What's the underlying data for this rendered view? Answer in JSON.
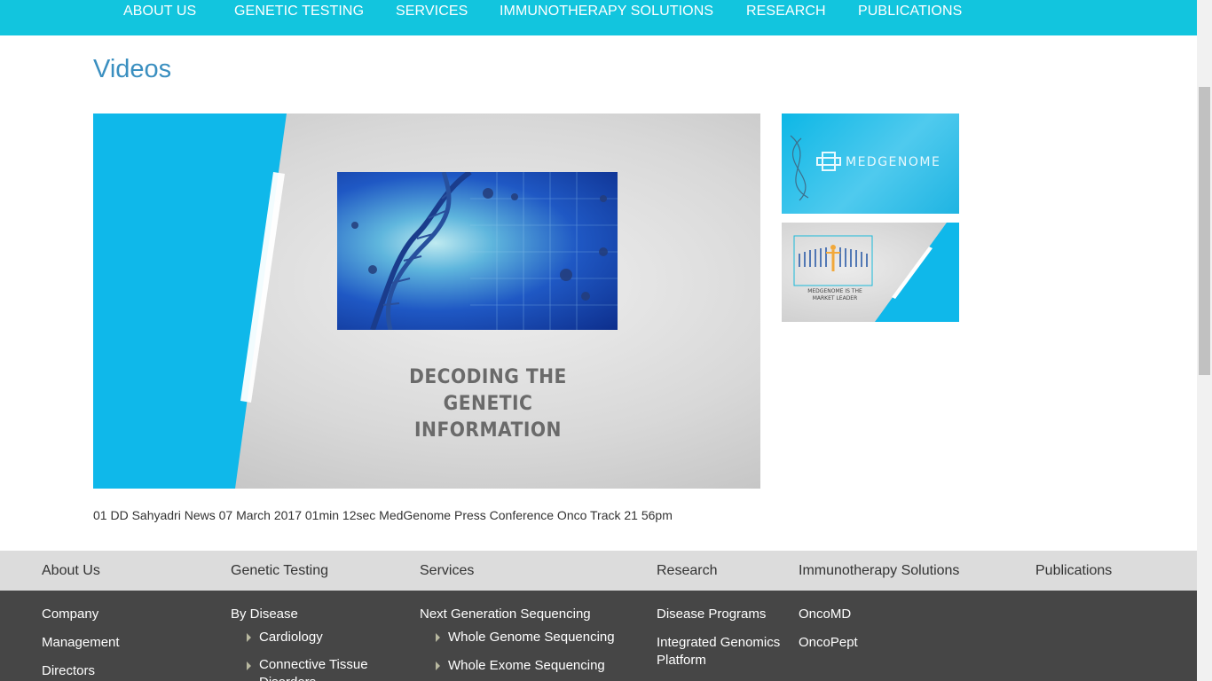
{
  "nav": {
    "items": [
      "ABOUT US",
      "GENETIC TESTING",
      "SERVICES",
      "IMMUNOTHERAPY SOLUTIONS",
      "RESEARCH",
      "PUBLICATIONS"
    ],
    "background": "#12c5de"
  },
  "main": {
    "title": "Videos",
    "featured_video": {
      "caption_line1": "DECODING THE GENETIC",
      "caption_line2": "INFORMATION"
    },
    "thumbnails": [
      {
        "text": "MEDGENOME"
      },
      {
        "text": "MEDGENOME IS THE MARKET LEADER"
      }
    ],
    "video_list_text": "01 DD Sahyadri News 07 March 2017 01min 12sec MedGenome Press Conference Onco Track 21 56pm"
  },
  "footer": {
    "headings": [
      "About Us",
      "Genetic Testing",
      "Services",
      "Research",
      "Immunotherapy Solutions",
      "Publications"
    ],
    "about": [
      "Company",
      "Management",
      "Directors"
    ],
    "genetic_testing": {
      "group": "By Disease",
      "items": [
        "Cardiology",
        "Connective Tissue Disorders"
      ]
    },
    "services": {
      "group": "Next Generation Sequencing",
      "items": [
        "Whole Genome Sequencing",
        "Whole Exome Sequencing"
      ]
    },
    "research": [
      "Disease Programs",
      "Integrated Genomics Platform"
    ],
    "immunotherapy": [
      "OncoMD",
      "OncoPept"
    ]
  },
  "colors": {
    "accent": "#12c5de",
    "title": "#3a8fc0",
    "footer_head": "#dcdcdc",
    "footer_body": "#464646"
  }
}
